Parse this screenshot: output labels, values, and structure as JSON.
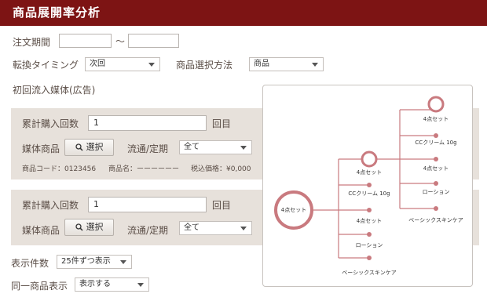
{
  "header": {
    "title": "商品展開率分析"
  },
  "form": {
    "period_label": "注文期間",
    "period_sep": "〜",
    "period_from": "",
    "period_to": "",
    "timing_label": "転換タイミング",
    "timing_value": "次回",
    "method_label": "商品選択方法",
    "method_value": "商品",
    "media_label": "初回流入媒体(広告)"
  },
  "panel1": {
    "count_label": "累計購入回数",
    "count_value": "1",
    "count_unit": "回目",
    "product_label": "媒体商品",
    "select_button": "選択",
    "flow_label": "流通/定期",
    "flow_value": "全て",
    "code_text": "商品コード：0123456",
    "name_text": "商品名：ーーーーーー",
    "price_text": "税込価格：¥0,000"
  },
  "panel2": {
    "count_label": "累計購入回数",
    "count_value": "1",
    "count_unit": "回目",
    "product_label": "媒体商品",
    "select_button": "選択",
    "flow_label": "流通/定期",
    "flow_value": "全て"
  },
  "display": {
    "count_label": "表示件数",
    "count_value": "25件ずつ表示",
    "same_label": "同一商品表示",
    "same_value": "表示する"
  },
  "tree": {
    "root": "4点セット",
    "level1": [
      "4点セット",
      "CCクリーム 10g",
      "4点セット",
      "ローション",
      "ベーシックスキンケア"
    ],
    "level2": [
      "4点セット",
      "CCクリーム 10g",
      "4点セット",
      "ローション",
      "ベーシックスキンケア"
    ]
  },
  "colors": {
    "header": "#7d1414",
    "panel": "#e7e1db",
    "node": "#c97a7f"
  }
}
